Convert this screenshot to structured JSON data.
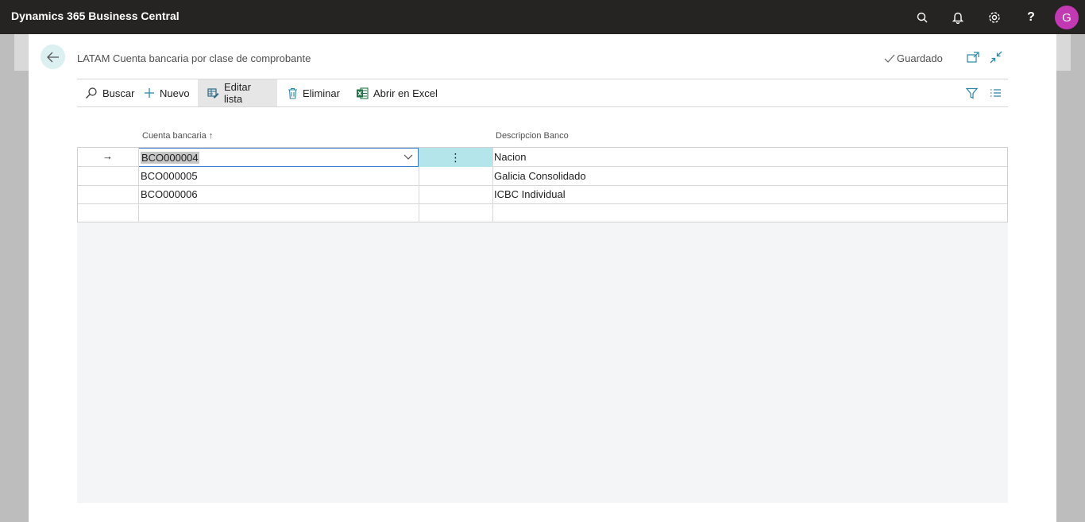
{
  "app": {
    "title": "Dynamics 365 Business Central",
    "avatar_initial": "G"
  },
  "topbar_icons": [
    "search-icon",
    "bell-icon",
    "gear-icon",
    "help-icon"
  ],
  "help_glyph": "?",
  "page": {
    "title": "LATAM Cuenta bancaria por clase de comprobante",
    "status": "Guardado"
  },
  "actions": {
    "search": "Buscar",
    "new": "Nuevo",
    "edit_list": "Editar lista",
    "delete": "Eliminar",
    "open_excel": "Abrir en Excel"
  },
  "columns": {
    "account": "Cuenta bancaria",
    "sort_glyph": "↑",
    "description": "Descripcion Banco"
  },
  "row_marker": "→",
  "dots": "⋮",
  "rows": [
    {
      "account": "BCO000004",
      "description": "Nacion"
    },
    {
      "account": "BCO000005",
      "description": "Galicia Consolidado"
    },
    {
      "account": "BCO000006",
      "description": "ICBC Individual"
    }
  ],
  "colors": {
    "topbar": "#252423",
    "avatar": "#c239b3",
    "accent_selected_cell": "#b3e5eb",
    "excel_green": "#217346"
  }
}
